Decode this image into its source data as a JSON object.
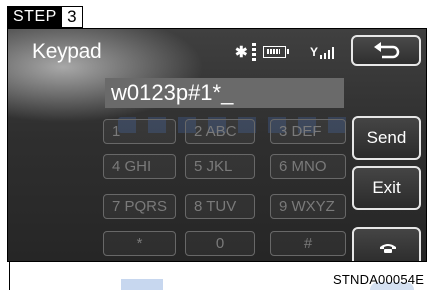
{
  "step": {
    "label": "STEP",
    "number": "3"
  },
  "screen": {
    "title": "Keypad",
    "dialed_number": "w0123p#1*_",
    "status_icons": [
      "bluetooth-icon",
      "battery-icon",
      "signal-strength-icon"
    ]
  },
  "keypad": [
    {
      "label": "1"
    },
    {
      "label": "2  ABC"
    },
    {
      "label": "3  DEF"
    },
    {
      "label": "4  GHI"
    },
    {
      "label": "5  JKL"
    },
    {
      "label": "6  MNO"
    },
    {
      "label": "7  PQRS"
    },
    {
      "label": "8  TUV"
    },
    {
      "label": "9  WXYZ"
    },
    {
      "label": "*"
    },
    {
      "label": "0"
    },
    {
      "label": "#"
    }
  ],
  "buttons": {
    "back_icon": "back-arrow-icon",
    "send": "Send",
    "exit": "Exit",
    "call_icon": "phone-icon"
  },
  "footer": {
    "code": "STNDA00054E"
  },
  "colors": {
    "screen_bg": "#333333",
    "field_bg": "#6a6a6a",
    "button_border": "#e6e6e6",
    "key_text_dim": "#7a7a7a"
  }
}
